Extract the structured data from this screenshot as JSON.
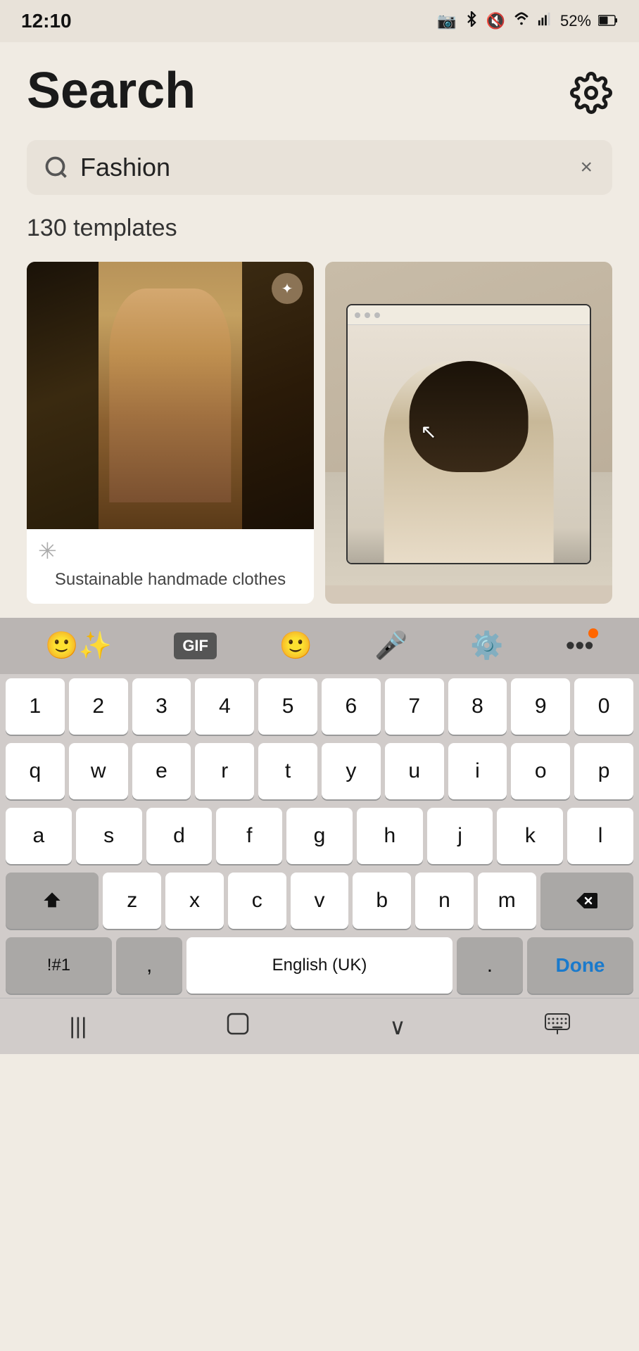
{
  "statusBar": {
    "time": "12:10",
    "icons": [
      "📷",
      "bluetooth",
      "mute",
      "wifi",
      "signal",
      "52%",
      "battery"
    ]
  },
  "header": {
    "title": "Search",
    "settingsLabel": "settings"
  },
  "searchBar": {
    "value": "Fashion",
    "placeholder": "Fashion",
    "clearLabel": "×"
  },
  "resultsCount": "130 templates",
  "cards": [
    {
      "caption": "Sustainable handmade clothes",
      "isPremium": true,
      "premiumIcon": "✦"
    },
    {
      "caption": "",
      "isPremium": false
    }
  ],
  "keyboard": {
    "toolbar": {
      "sticker": "🙂✨",
      "gif": "GIF",
      "emoji": "🙂",
      "mic": "🎤",
      "settings": "⚙",
      "more": "•••"
    },
    "rows": {
      "numbers": [
        "1",
        "2",
        "3",
        "4",
        "5",
        "6",
        "7",
        "8",
        "9",
        "0"
      ],
      "row1": [
        "q",
        "w",
        "e",
        "r",
        "t",
        "y",
        "u",
        "i",
        "o",
        "p"
      ],
      "row2": [
        "a",
        "s",
        "d",
        "f",
        "g",
        "h",
        "j",
        "k",
        "l"
      ],
      "row3": [
        "z",
        "x",
        "c",
        "v",
        "b",
        "n",
        "m"
      ],
      "spaceLabel": "English (UK)",
      "doneLabel": "Done"
    }
  },
  "bottomNav": {
    "back": "|||",
    "home": "○",
    "recents": "∨",
    "keyboard": "⌨"
  }
}
